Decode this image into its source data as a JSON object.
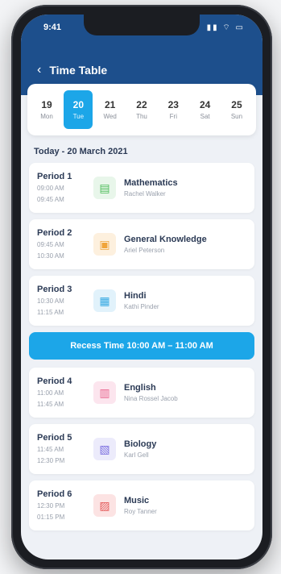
{
  "status": {
    "time": "9:41",
    "icons": "▮▮ ⌔ ▭"
  },
  "header": {
    "back_icon": "‹",
    "title": "Time Table"
  },
  "dates": [
    {
      "num": "19",
      "day": "Mon",
      "active": false
    },
    {
      "num": "20",
      "day": "Tue",
      "active": true
    },
    {
      "num": "21",
      "day": "Wed",
      "active": false
    },
    {
      "num": "22",
      "day": "Thu",
      "active": false
    },
    {
      "num": "23",
      "day": "Fri",
      "active": false
    },
    {
      "num": "24",
      "day": "Sat",
      "active": false
    },
    {
      "num": "25",
      "day": "Sun",
      "active": false
    }
  ],
  "today_label": "Today - 20 March 2021",
  "periods": [
    {
      "name": "Period 1",
      "time1": "09:00 AM",
      "time2": "09:45 AM",
      "subject": "Mathematics",
      "teacher": "Rachel Walker",
      "color": "#4ebc5b",
      "icon": "▤"
    },
    {
      "name": "Period 2",
      "time1": "09:45 AM",
      "time2": "10:30 AM",
      "subject": "General Knowledge",
      "teacher": "Ariel Peterson",
      "color": "#f0a43a",
      "icon": "▣"
    },
    {
      "name": "Period 3",
      "time1": "10:30 AM",
      "time2": "11:15 AM",
      "subject": "Hindi",
      "teacher": "Kathi Pinder",
      "color": "#35a9e3",
      "icon": "▦"
    }
  ],
  "recess": "Recess Time 10:00 AM – 11:00 AM",
  "periods_after": [
    {
      "name": "Period 4",
      "time1": "11:00 AM",
      "time2": "11:45 AM",
      "subject": "English",
      "teacher": "Nina Rossel Jacob",
      "color": "#e9668f",
      "icon": "▥"
    },
    {
      "name": "Period 5",
      "time1": "11:45 AM",
      "time2": "12:30 PM",
      "subject": "Biology",
      "teacher": "Karl Gell",
      "color": "#7b6ee0",
      "icon": "▧"
    },
    {
      "name": "Period 6",
      "time1": "12:30 PM",
      "time2": "01:15 PM",
      "subject": "Music",
      "teacher": "Roy Tanner",
      "color": "#e45a5a",
      "icon": "▨"
    }
  ]
}
